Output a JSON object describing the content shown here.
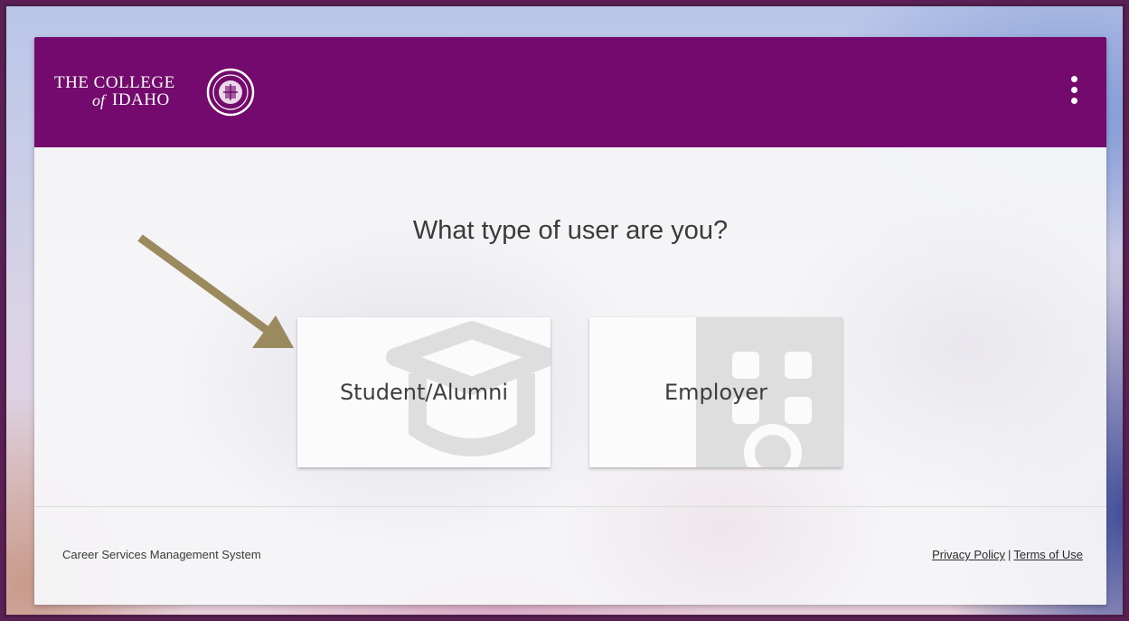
{
  "header": {
    "logo": {
      "line1": "THE COLLEGE",
      "of": "of",
      "line2": "IDAHO"
    },
    "menu_icon": "more-vertical-icon",
    "background_color": "#750a6e"
  },
  "main": {
    "question": "What type of user are you?",
    "choices": [
      {
        "label": "Student/Alumni",
        "icon": "graduation-cap-icon"
      },
      {
        "label": "Employer",
        "icon": "building-icon"
      }
    ]
  },
  "footer": {
    "system_name": "Career Services Management System",
    "privacy_policy": "Privacy Policy",
    "separator": "|",
    "terms_of_use": "Terms of Use"
  },
  "annotation": {
    "arrow_color": "#9a8a5e"
  }
}
